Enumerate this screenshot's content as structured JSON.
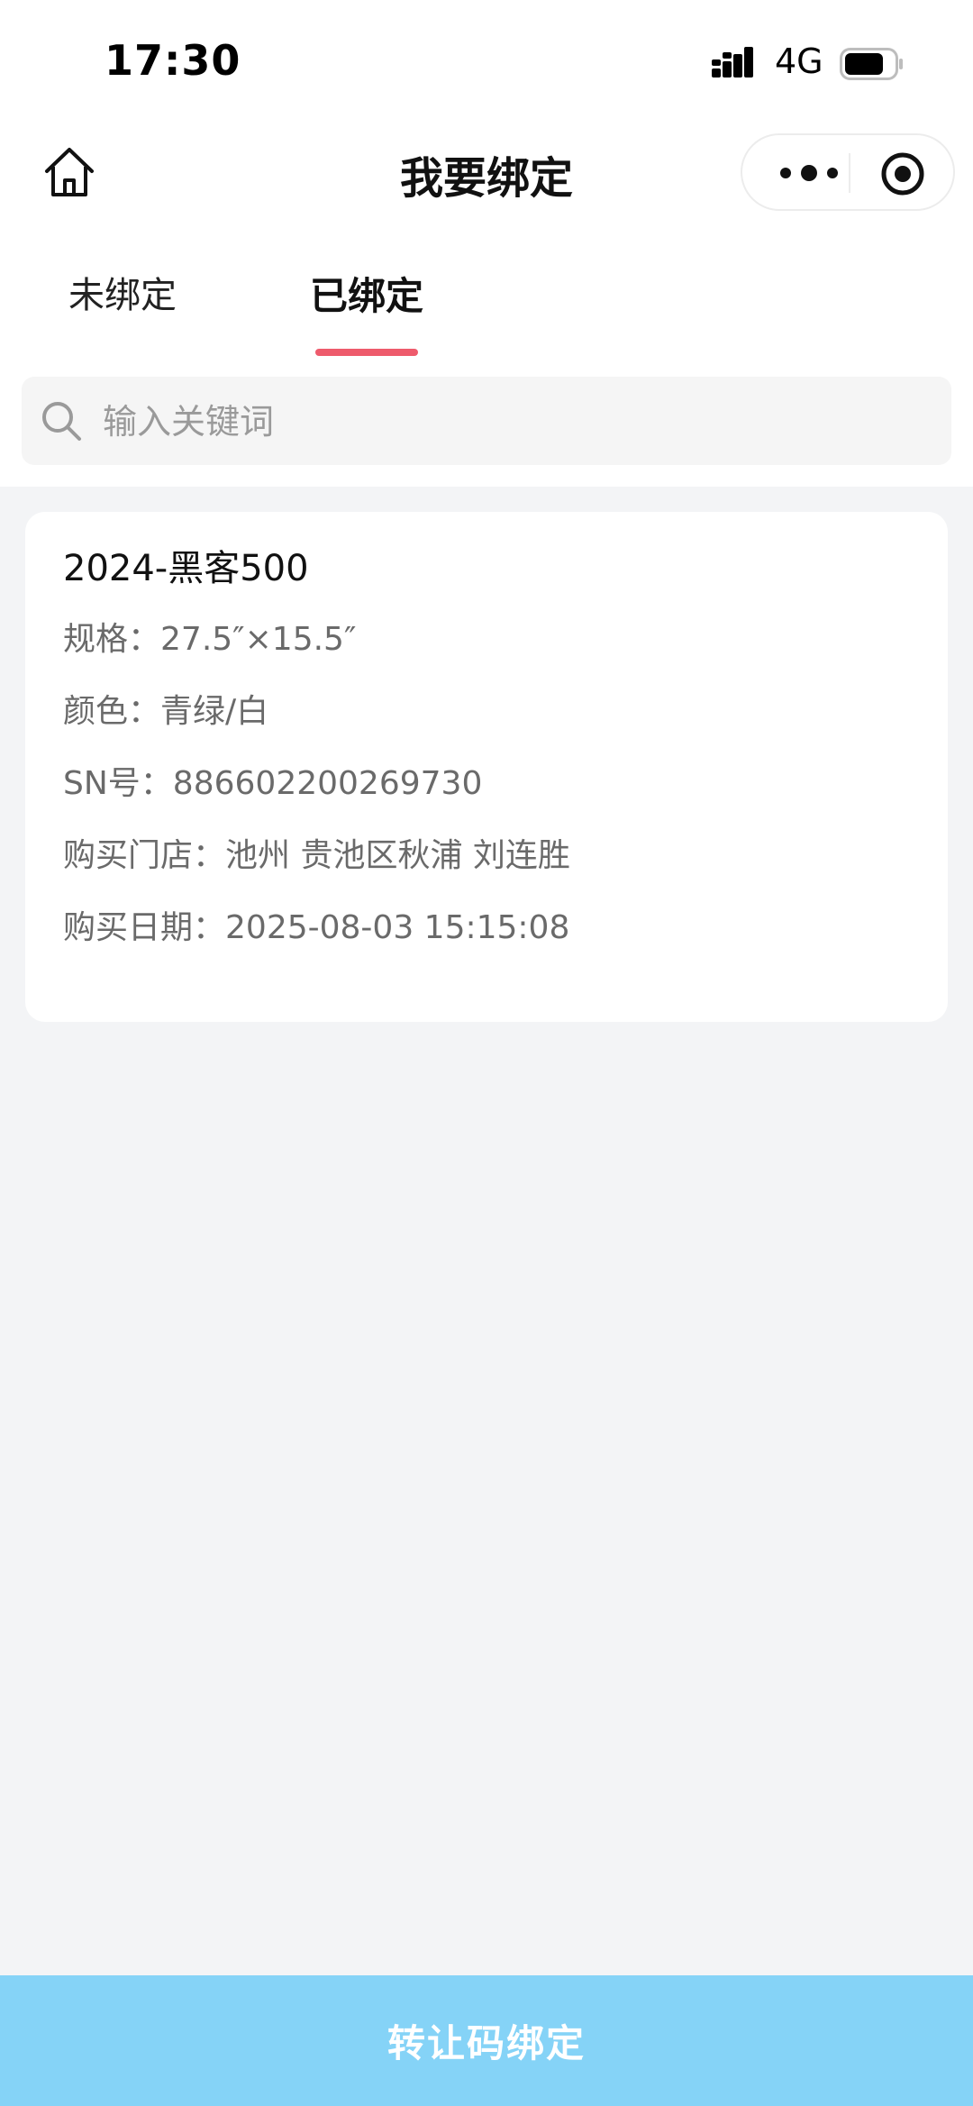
{
  "status_bar": {
    "time": "17:30",
    "network": "4G",
    "icons": [
      "signal-icon",
      "battery-icon"
    ]
  },
  "nav": {
    "title": "我要绑定",
    "icons": [
      "home-icon",
      "more-icon",
      "target-icon"
    ]
  },
  "tabs": [
    {
      "label": "未绑定",
      "active": false
    },
    {
      "label": "已绑定",
      "active": true
    }
  ],
  "search": {
    "placeholder": "输入关键词",
    "value": "",
    "icon": "search-icon"
  },
  "card": {
    "title": "2024-黑客500",
    "rows": [
      {
        "label": "规格：",
        "value": "27.5″×15.5″"
      },
      {
        "label": "颜色：",
        "value": "青绿/白"
      },
      {
        "label": "SN号：",
        "value": "886602200269730"
      },
      {
        "label": "购买门店：",
        "value": "池州 贵池区秋浦 刘连胜"
      },
      {
        "label": "购买日期：",
        "value": "2025-08-03 15:15:08"
      }
    ]
  },
  "bottom_button": {
    "label": "转让码绑定"
  },
  "colors": {
    "accent_underline": "#ee5b6c",
    "bottom_button_bg": "#85d3f7",
    "page_bg": "#f3f4f6"
  }
}
